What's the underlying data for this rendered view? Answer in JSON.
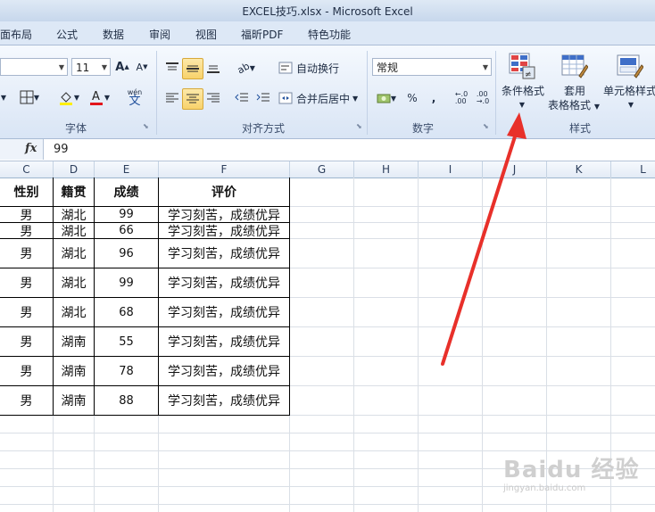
{
  "window": {
    "title": "EXCEL技巧.xlsx - Microsoft Excel"
  },
  "tabs": [
    "面布局",
    "公式",
    "数据",
    "审阅",
    "视图",
    "福昕PDF",
    "特色功能"
  ],
  "ribbon": {
    "font": {
      "size": "11",
      "label": "字体",
      "phonetic_label": "wén"
    },
    "alignment": {
      "wrap_text": "自动换行",
      "merge_center": "合并后居中",
      "label": "对齐方式"
    },
    "number": {
      "format": "常规",
      "percent": "%",
      "comma": ",",
      "label": "数字"
    },
    "styles": {
      "conditional_format": "条件格式",
      "table_format_line1": "套用",
      "table_format_line2": "表格格式",
      "cell_styles": "单元格样式",
      "label": "样式"
    }
  },
  "formula_bar": {
    "fx": "fx",
    "value": "99"
  },
  "columns": [
    "C",
    "D",
    "E",
    "F",
    "G",
    "H",
    "I",
    "J",
    "K",
    "L"
  ],
  "table": {
    "headers": [
      "性别",
      "籍贯",
      "成绩",
      "评价"
    ],
    "rows": [
      [
        "男",
        "湖北",
        "99",
        "学习刻苦，成绩优异"
      ],
      [
        "男",
        "湖北",
        "66",
        "学习刻苦，成绩优异"
      ],
      [
        "男",
        "湖北",
        "96",
        "学习刻苦，成绩优异"
      ],
      [
        "男",
        "湖北",
        "99",
        "学习刻苦，成绩优异"
      ],
      [
        "男",
        "湖北",
        "68",
        "学习刻苦，成绩优异"
      ],
      [
        "男",
        "湖南",
        "55",
        "学习刻苦，成绩优异"
      ],
      [
        "男",
        "湖南",
        "78",
        "学习刻苦，成绩优异"
      ],
      [
        "男",
        "湖南",
        "88",
        "学习刻苦，成绩优异"
      ]
    ]
  },
  "watermark": {
    "main": "Baidu 经验",
    "sub": "jingyan.baidu.com"
  },
  "colors": {
    "annotation_arrow": "#e8302a",
    "highlight": "#f8d26b"
  }
}
